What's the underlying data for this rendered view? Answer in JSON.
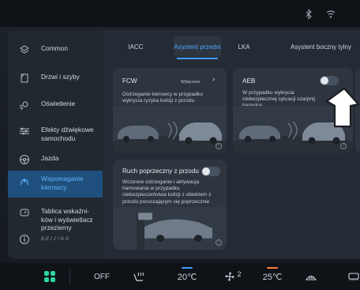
{
  "status_icons": [
    "bluetooth-icon",
    "wifi-icon"
  ],
  "sidebar": {
    "items": [
      {
        "label": "Common",
        "icon": "layers-icon"
      },
      {
        "label": "Drzwi i szyby",
        "icon": "door-icon"
      },
      {
        "label": "Oświetlenie",
        "icon": "light-icon"
      },
      {
        "label": "Efekty dźwiękowe samochodu",
        "icon": "equalizer-icon"
      },
      {
        "label": "Jazda",
        "icon": "steering-wheel-icon"
      },
      {
        "label": "Wspomaganie kierowcy",
        "icon": "driver-assist-icon"
      },
      {
        "label": "Tablica wskaźni-ków i wyświetlacz przezierny",
        "icon": "gauge-icon"
      }
    ],
    "active_index": 5,
    "info_icon": "info-icon",
    "logo_text": "BEIJING"
  },
  "tabs": [
    "IACC",
    "Asystent przedni",
    "LKA",
    "Asystent boczny tylny"
  ],
  "active_tab_index": 1,
  "cards": {
    "fcw": {
      "title": "FCW",
      "status": "Wyłączone",
      "description": "Ostrzeganie kierowcy w przypadku wykrycia ryzyka kolizji z przodu"
    },
    "aeb": {
      "title": "AEB",
      "toggle_on": false,
      "description": "W przypadku wykrycia niebezpiecznej sytuacji szarpnij hamulce"
    },
    "cross_traffic": {
      "title": "Ruch poprzeczny z przodu",
      "toggle_on": false,
      "description": "Wczesne ostrzeganie i aktywacja hamowania w przypadku niebezpieczeństwa kolizji z obiektem z przodu poruszającym się poprzecznie"
    }
  },
  "bottombar": {
    "off_label": "OFF",
    "driver_temp": "20℃",
    "fan_level": "2",
    "passenger_temp": "25℃"
  },
  "colors": {
    "accent": "#3d9bff",
    "active_sidebar_bg": "#1f4f7c",
    "driver_temp_bar": "#3d9bff",
    "passenger_temp_bar": "#ff7b3a",
    "apps_icon": "#2ed6a4"
  }
}
